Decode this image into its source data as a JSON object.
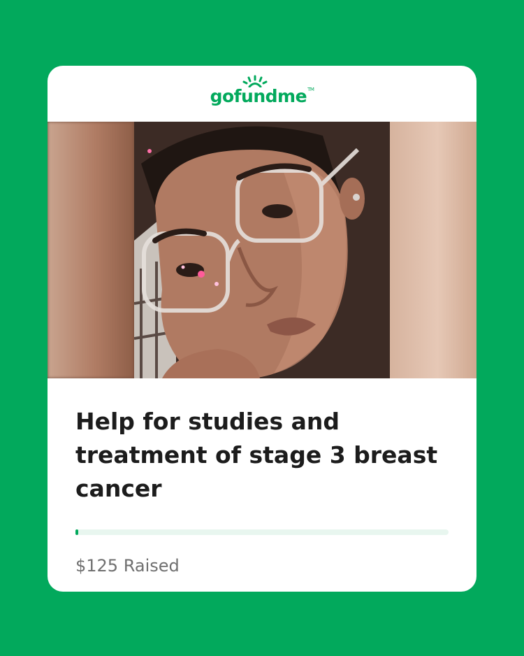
{
  "brand": {
    "name": "gofundme",
    "logo_text_left": "gof",
    "logo_text_u": "u",
    "logo_text_right": "ndme",
    "trademark": "TM",
    "color": "#02a95c"
  },
  "campaign": {
    "photo_icon": "campaign-photo",
    "title": "Help for studies and treatment of stage 3 breast cancer",
    "raised_text": "$125 Raised",
    "progress_fraction": 0.008
  },
  "colors": {
    "background": "#02a95c",
    "card": "#ffffff",
    "title": "#1c1c1c",
    "raised": "#6f6f6f",
    "track": "#e8f6ef"
  }
}
